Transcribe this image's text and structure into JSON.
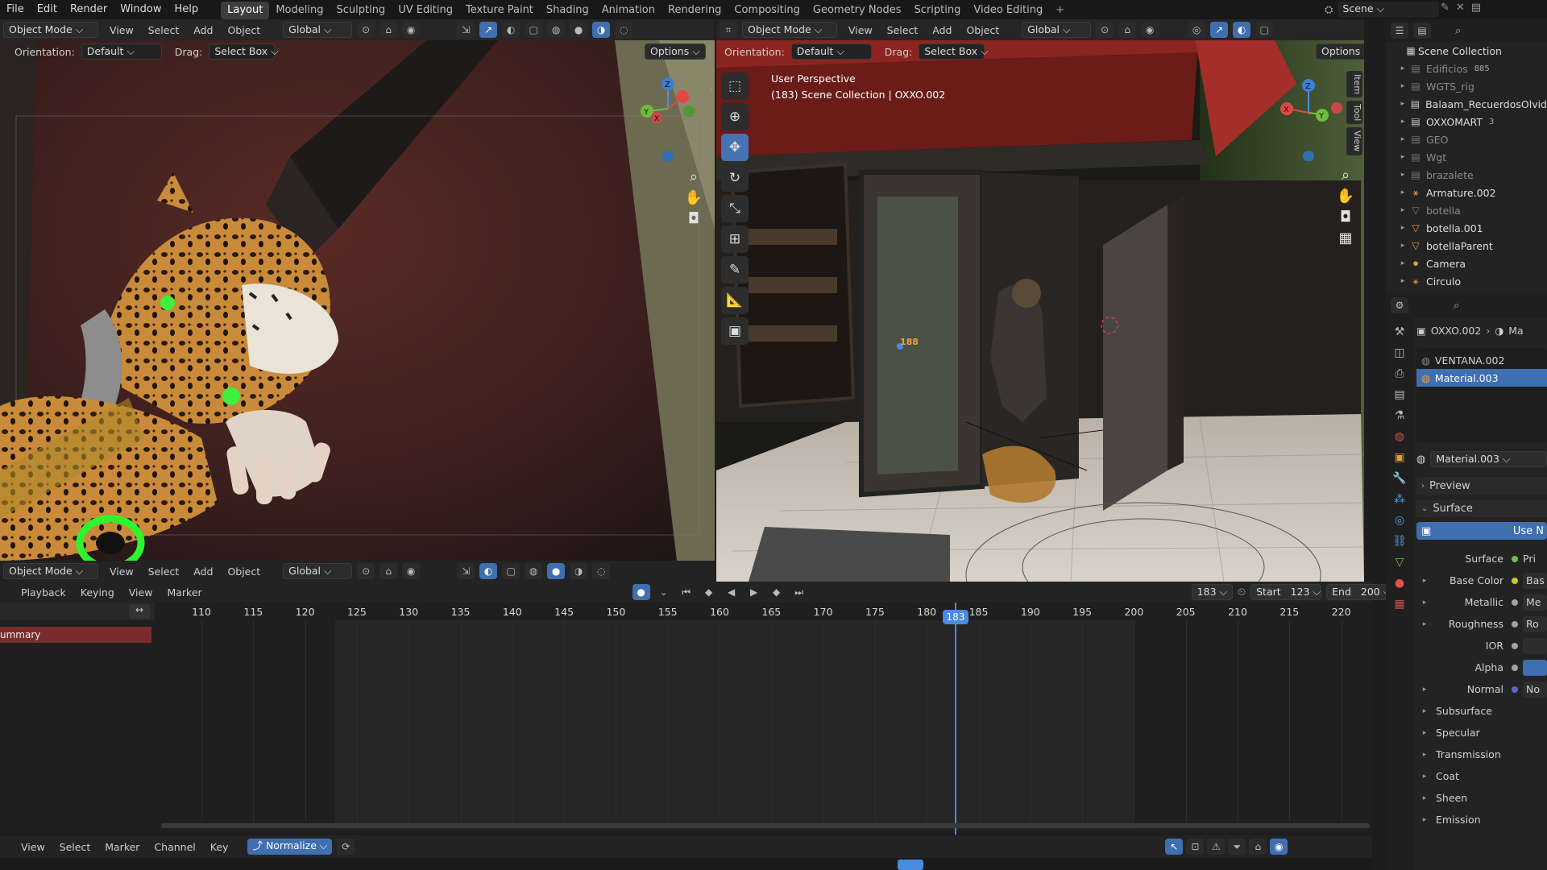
{
  "menu": [
    "File",
    "Edit",
    "Render",
    "Window",
    "Help"
  ],
  "workspaces": [
    "Layout",
    "Modeling",
    "Sculpting",
    "UV Editing",
    "Texture Paint",
    "Shading",
    "Animation",
    "Rendering",
    "Compositing",
    "Geometry Nodes",
    "Scripting",
    "Video Editing"
  ],
  "active_workspace": "Layout",
  "scene_label": "Scene",
  "viewport_left": {
    "mode": "Object Mode",
    "menus": [
      "View",
      "Select",
      "Add",
      "Object"
    ],
    "transform": "Global",
    "orientation_label": "Orientation:",
    "orientation_value": "Default",
    "drag_label": "Drag:",
    "drag_value": "Select Box",
    "options_label": "Options",
    "gizmo": {
      "z": "Z",
      "y": "Y",
      "x": "X"
    }
  },
  "viewport_bottom_left": {
    "mode": "Object Mode",
    "menus": [
      "View",
      "Select",
      "Add",
      "Object"
    ],
    "transform": "Global"
  },
  "viewport_right": {
    "mode": "Object Mode",
    "menus": [
      "View",
      "Select",
      "Add",
      "Object"
    ],
    "transform": "Global",
    "orientation_label": "Orientation:",
    "orientation_value": "Default",
    "drag_label": "Drag:",
    "drag_value": "Select Box",
    "options_label": "Options",
    "perspective": "User Perspective",
    "info": "(183) Scene Collection | OXXO.002",
    "side_tabs": [
      "Item",
      "Tool",
      "View"
    ],
    "frame_marker": "188",
    "gizmo": {
      "z": "Z",
      "y": "Y",
      "x": "X"
    }
  },
  "timeline": {
    "menus": [
      "Playback",
      "Keying",
      "View",
      "Marker"
    ],
    "current_frame": "183",
    "start_label": "Start",
    "start": "123",
    "end_label": "End",
    "end": "200",
    "ticks": [
      "110",
      "115",
      "120",
      "125",
      "130",
      "135",
      "140",
      "145",
      "150",
      "155",
      "160",
      "165",
      "170",
      "175",
      "180",
      "185",
      "190",
      "195",
      "200",
      "205",
      "210",
      "215",
      "220"
    ],
    "summary_label": "ummary"
  },
  "graph_editor": {
    "menus": [
      "View",
      "Select",
      "Marker",
      "Channel",
      "Key"
    ],
    "normalize_label": "Normalize"
  },
  "outliner": {
    "root": "Scene Collection",
    "items": [
      {
        "name": "Edificios",
        "icon": "collection-icon",
        "extra": "885",
        "dim": true
      },
      {
        "name": "WGTS_rig",
        "icon": "collection-icon",
        "extra": "",
        "dim": true
      },
      {
        "name": "Balaam_RecuerdosOlvid",
        "icon": "collection-icon",
        "extra": "",
        "dim": false
      },
      {
        "name": "OXXOMART",
        "icon": "collection-icon",
        "extra": "3",
        "dim": false
      },
      {
        "name": "GEO",
        "icon": "collection-icon",
        "extra": "",
        "dim": true
      },
      {
        "name": "Wgt",
        "icon": "collection-icon",
        "extra": "",
        "dim": true
      },
      {
        "name": "brazalete",
        "icon": "collection-icon",
        "extra": "",
        "dim": true
      },
      {
        "name": "Armature.002",
        "icon": "armature-icon",
        "extra": "",
        "dim": false
      },
      {
        "name": "botella",
        "icon": "mesh-icon",
        "extra": "",
        "dim": true
      },
      {
        "name": "botella.001",
        "icon": "mesh-icon",
        "extra": "",
        "dim": false
      },
      {
        "name": "botellaParent",
        "icon": "mesh-icon",
        "extra": "",
        "dim": false
      },
      {
        "name": "Camera",
        "icon": "camera-icon",
        "extra": "",
        "dim": false
      },
      {
        "name": "Circulo",
        "icon": "armature-icon",
        "extra": "",
        "dim": false
      }
    ]
  },
  "properties": {
    "breadcrumb_object": "OXXO.002",
    "breadcrumb_next": "Ma",
    "material_slots": [
      "VENTANA.002",
      "Material.003"
    ],
    "selected_slot": "Material.003",
    "material_name": "Material.003",
    "sections": {
      "preview": "Preview",
      "surface": "Surface"
    },
    "use_nodes_label": "Use N",
    "surface_label": "Surface",
    "surface_value": "Pri",
    "inputs": [
      {
        "label": "Base Color",
        "value": "Bas",
        "dot": "#c7c729",
        "has_tri": true
      },
      {
        "label": "Metallic",
        "value": "Me",
        "dot": "#a1a1a1",
        "has_tri": true
      },
      {
        "label": "Roughness",
        "value": "Ro",
        "dot": "#a1a1a1",
        "has_tri": true
      },
      {
        "label": "IOR",
        "value": "",
        "dot": "#a1a1a1",
        "has_tri": false
      },
      {
        "label": "Alpha",
        "value": "",
        "dot": "#a1a1a1",
        "has_tri": false
      },
      {
        "label": "Normal",
        "value": "No",
        "dot": "#6363c7",
        "has_tri": true
      }
    ],
    "subpanels": [
      "Subsurface",
      "Specular",
      "Transmission",
      "Coat",
      "Sheen",
      "Emission"
    ]
  }
}
